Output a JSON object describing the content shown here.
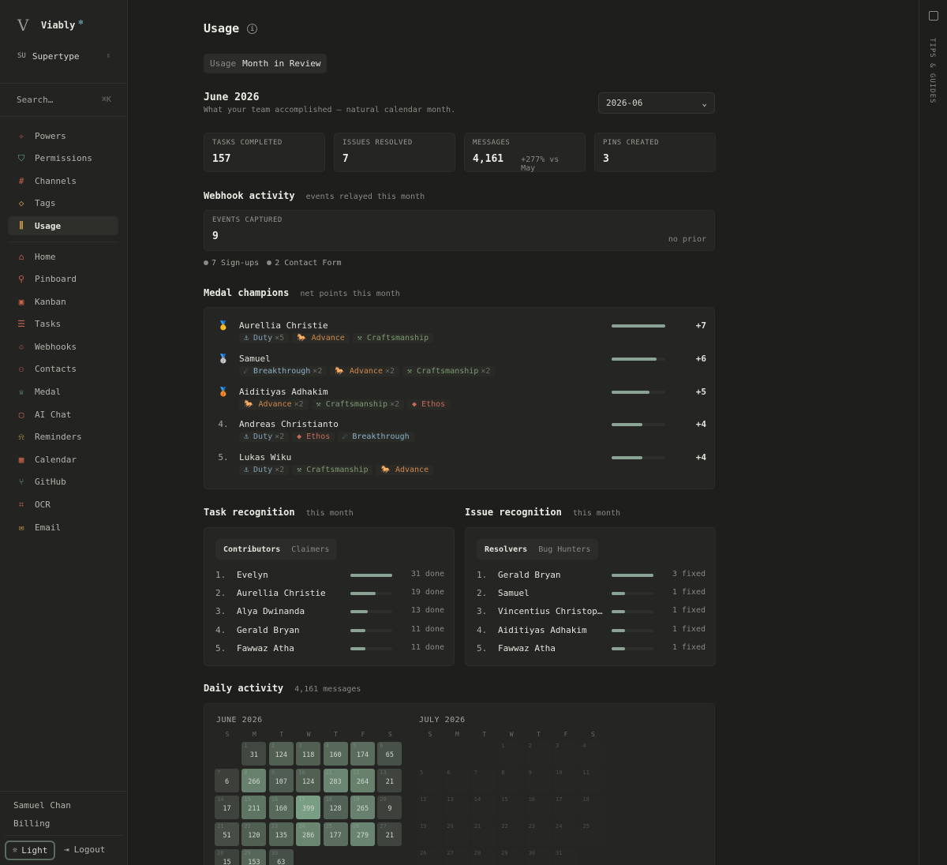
{
  "brand": {
    "name": "Viably"
  },
  "workspace": {
    "badge": "SU",
    "name": "Supertype"
  },
  "search": {
    "placeholder": "Search…",
    "shortcut": "⌘K"
  },
  "nav_primary": [
    {
      "label": "Powers",
      "icon": "bolt-icon",
      "glyph": "✧",
      "color": "#c8644a"
    },
    {
      "label": "Permissions",
      "icon": "shield-icon",
      "glyph": "⛉",
      "color": "#6aa878"
    },
    {
      "label": "Channels",
      "icon": "hash-icon",
      "glyph": "#",
      "color": "#c8644a"
    },
    {
      "label": "Tags",
      "icon": "tag-icon",
      "glyph": "◇",
      "color": "#c89a4a"
    },
    {
      "label": "Usage",
      "icon": "bar-chart-icon",
      "glyph": "⫼",
      "color": "#c89a4a",
      "active": true
    }
  ],
  "nav_secondary": [
    {
      "label": "Home",
      "icon": "home-icon",
      "glyph": "⌂",
      "color": "#c8644a"
    },
    {
      "label": "Pinboard",
      "icon": "pin-icon",
      "glyph": "⚲",
      "color": "#c8644a"
    },
    {
      "label": "Kanban",
      "icon": "kanban-icon",
      "glyph": "▣",
      "color": "#c8644a"
    },
    {
      "label": "Tasks",
      "icon": "list-icon",
      "glyph": "☰",
      "color": "#c8644a"
    },
    {
      "label": "Webhooks",
      "icon": "webhook-icon",
      "glyph": "♲",
      "color": "#c8644a"
    },
    {
      "label": "Contacts",
      "icon": "users-icon",
      "glyph": "⚇",
      "color": "#c8644a"
    },
    {
      "label": "Medal",
      "icon": "medal-icon",
      "glyph": "♕",
      "color": "#6aa878"
    },
    {
      "label": "AI Chat",
      "icon": "chat-icon",
      "glyph": "▢",
      "color": "#c8644a"
    },
    {
      "label": "Reminders",
      "icon": "bell-icon",
      "glyph": "⍾",
      "color": "#c89a4a"
    },
    {
      "label": "Calendar",
      "icon": "calendar-icon",
      "glyph": "▦",
      "color": "#c8644a"
    },
    {
      "label": "GitHub",
      "icon": "git-branch-icon",
      "glyph": "⑂",
      "color": "#6aa878"
    },
    {
      "label": "OCR",
      "icon": "scan-icon",
      "glyph": "⌗",
      "color": "#c8644a"
    },
    {
      "label": "Email",
      "icon": "mail-icon",
      "glyph": "✉",
      "color": "#c89a4a"
    }
  ],
  "footer": {
    "user": "Samuel Chan",
    "billing": "Billing",
    "theme": "Light",
    "logout": "Logout"
  },
  "rail": {
    "label": "TIPS & GUIDES"
  },
  "page": {
    "title": "Usage",
    "tabs": [
      "Usage",
      "Month in Review"
    ],
    "month": "June 2026",
    "month_sub": "What your team accomplished — natural calendar month.",
    "month_select": "2026-06"
  },
  "stats": [
    {
      "label": "TASKS COMPLETED",
      "value": "157",
      "delta": ""
    },
    {
      "label": "ISSUES RESOLVED",
      "value": "7",
      "delta": ""
    },
    {
      "label": "MESSAGES",
      "value": "4,161",
      "delta": "+277% vs May"
    },
    {
      "label": "PINS CREATED",
      "value": "3",
      "delta": ""
    }
  ],
  "webhook": {
    "title": "Webhook activity",
    "sub": "events relayed this month",
    "label": "EVENTS CAPTURED",
    "value": "9",
    "prior": "no prior",
    "legend": [
      "7 Sign-ups",
      "2 Contact Form"
    ]
  },
  "medals": {
    "title": "Medal champions",
    "sub": "net points this month",
    "rows": [
      {
        "rank": "🥇",
        "name": "Aurellia Christie",
        "points": "+7",
        "level": 1.0,
        "tags": [
          {
            "kind": "duty",
            "label": "⚓ Duty",
            "x": "×5"
          },
          {
            "kind": "adv",
            "label": "🐎 Advance",
            "x": ""
          },
          {
            "kind": "craft",
            "label": "⚒ Craftsmanship",
            "x": ""
          }
        ]
      },
      {
        "rank": "🥈",
        "name": "Samuel",
        "points": "+6",
        "level": 0.84,
        "tags": [
          {
            "kind": "break",
            "label": "☄ Breakthrough",
            "x": "×2"
          },
          {
            "kind": "adv",
            "label": "🐎 Advance",
            "x": "×2"
          },
          {
            "kind": "craft",
            "label": "⚒ Craftsmanship",
            "x": "×2"
          }
        ]
      },
      {
        "rank": "🥉",
        "name": "Aiditiyas Adhakim",
        "points": "+5",
        "level": 0.7,
        "tags": [
          {
            "kind": "adv",
            "label": "🐎 Advance",
            "x": "×2"
          },
          {
            "kind": "craft",
            "label": "⚒ Craftsmanship",
            "x": "×2"
          },
          {
            "kind": "ethos",
            "label": "◆ Ethos",
            "x": ""
          }
        ]
      },
      {
        "rank": "4.",
        "name": "Andreas Christianto",
        "points": "+4",
        "level": 0.57,
        "tags": [
          {
            "kind": "duty",
            "label": "⚓ Duty",
            "x": "×2"
          },
          {
            "kind": "ethos",
            "label": "◆ Ethos",
            "x": ""
          },
          {
            "kind": "break",
            "label": "☄ Breakthrough",
            "x": ""
          }
        ]
      },
      {
        "rank": "5.",
        "name": "Lukas Wiku",
        "points": "+4",
        "level": 0.57,
        "tags": [
          {
            "kind": "duty",
            "label": "⚓ Duty",
            "x": "×2"
          },
          {
            "kind": "craft",
            "label": "⚒ Craftsmanship",
            "x": ""
          },
          {
            "kind": "adv",
            "label": "🐎 Advance",
            "x": ""
          }
        ]
      }
    ]
  },
  "task_recognition": {
    "title": "Task recognition",
    "sub": "this month",
    "tabs": [
      "Contributors",
      "Claimers"
    ],
    "rows": [
      {
        "rank": "1.",
        "name": "Evelyn",
        "value": "31 done",
        "level": 1.0
      },
      {
        "rank": "2.",
        "name": "Aurellia Christie",
        "value": "19 done",
        "level": 0.61
      },
      {
        "rank": "3.",
        "name": "Alya Dwinanda",
        "value": "13 done",
        "level": 0.42
      },
      {
        "rank": "4.",
        "name": "Gerald Bryan",
        "value": "11 done",
        "level": 0.35
      },
      {
        "rank": "5.",
        "name": "Fawwaz Atha",
        "value": "11 done",
        "level": 0.35
      }
    ]
  },
  "issue_recognition": {
    "title": "Issue recognition",
    "sub": "this month",
    "tabs": [
      "Resolvers",
      "Bug Hunters"
    ],
    "rows": [
      {
        "rank": "1.",
        "name": "Gerald Bryan",
        "value": "3 fixed",
        "level": 1.0
      },
      {
        "rank": "2.",
        "name": "Samuel",
        "value": "1 fixed",
        "level": 0.33
      },
      {
        "rank": "3.",
        "name": "Vincentius Christop…",
        "value": "1 fixed",
        "level": 0.33
      },
      {
        "rank": "4.",
        "name": "Aiditiyas Adhakim",
        "value": "1 fixed",
        "level": 0.33
      },
      {
        "rank": "5.",
        "name": "Fawwaz Atha",
        "value": "1 fixed",
        "level": 0.33
      }
    ]
  },
  "daily": {
    "title": "Daily activity",
    "sub": "4,161 messages",
    "dow": [
      "S",
      "M",
      "T",
      "W",
      "T",
      "F",
      "S"
    ],
    "june": {
      "label": "JUNE 2026",
      "weeks": [
        [
          null,
          [
            1,
            31
          ],
          [
            2,
            124
          ],
          [
            3,
            118
          ],
          [
            4,
            160
          ],
          [
            5,
            174
          ],
          [
            6,
            65
          ]
        ],
        [
          [
            7,
            6
          ],
          [
            8,
            266
          ],
          [
            9,
            107
          ],
          [
            10,
            124
          ],
          [
            11,
            283
          ],
          [
            12,
            264
          ],
          [
            13,
            21
          ]
        ],
        [
          [
            14,
            17
          ],
          [
            15,
            211
          ],
          [
            16,
            160
          ],
          [
            17,
            399
          ],
          [
            18,
            128
          ],
          [
            19,
            265
          ],
          [
            20,
            9
          ]
        ],
        [
          [
            21,
            51
          ],
          [
            22,
            120
          ],
          [
            23,
            135
          ],
          [
            24,
            286
          ],
          [
            25,
            177
          ],
          [
            26,
            279
          ],
          [
            27,
            21
          ]
        ],
        [
          [
            28,
            15
          ],
          [
            29,
            153
          ],
          [
            30,
            63
          ],
          null,
          null,
          null,
          null
        ]
      ]
    },
    "july": {
      "label": "JULY 2026",
      "weeks": [
        [
          null,
          null,
          null,
          [
            1,
            null
          ],
          [
            2,
            null
          ],
          [
            3,
            null
          ],
          [
            4,
            null
          ]
        ],
        [
          [
            5,
            null
          ],
          [
            6,
            null
          ],
          [
            7,
            null
          ],
          [
            8,
            null
          ],
          [
            9,
            null
          ],
          [
            10,
            null
          ],
          [
            11,
            null
          ]
        ],
        [
          [
            12,
            null
          ],
          [
            13,
            null
          ],
          [
            14,
            null
          ],
          [
            15,
            null
          ],
          [
            16,
            null
          ],
          [
            17,
            null
          ],
          [
            18,
            null
          ]
        ],
        [
          [
            19,
            null
          ],
          [
            20,
            null
          ],
          [
            21,
            null
          ],
          [
            22,
            null
          ],
          [
            23,
            null
          ],
          [
            24,
            null
          ],
          [
            25,
            null
          ]
        ],
        [
          [
            26,
            null
          ],
          [
            27,
            null
          ],
          [
            28,
            null
          ],
          [
            29,
            null
          ],
          [
            30,
            null
          ],
          [
            31,
            null
          ],
          null
        ]
      ]
    }
  }
}
